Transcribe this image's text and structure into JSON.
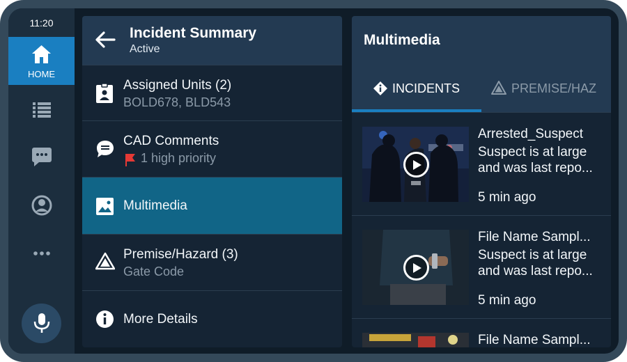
{
  "status": {
    "time": "11:20"
  },
  "rail": {
    "home_label": "HOME",
    "items": [
      "home-icon",
      "list-icon",
      "chat-icon",
      "profile-icon",
      "more-icon",
      "microphone-icon"
    ]
  },
  "incident": {
    "title": "Incident Summary",
    "status": "Active",
    "rows": [
      {
        "label": "Assigned Units (2)",
        "sub": "BOLD678, BLD543",
        "icon": "badge-icon"
      },
      {
        "label": "CAD Comments",
        "sub": "1 high priority",
        "icon": "comment-icon",
        "flag_color": "#e53935"
      },
      {
        "label": "Multimedia",
        "sub": "",
        "icon": "image-icon",
        "selected": true
      },
      {
        "label": "Premise/Hazard (3)",
        "sub": "Gate Code",
        "icon": "hazard-icon"
      },
      {
        "label": "More Details",
        "sub": "",
        "icon": "info-icon"
      }
    ]
  },
  "multimedia": {
    "title": "Multimedia",
    "tabs": [
      {
        "label": "INCIDENTS",
        "icon": "info-diamond-icon",
        "active": true
      },
      {
        "label": "PREMISE/HAZ",
        "icon": "hazard-icon",
        "active": false
      }
    ],
    "items": [
      {
        "name": "Arrested_Suspect",
        "desc": "Suspect is at large and was last repo...",
        "ago": "5 min ago"
      },
      {
        "name": "File Name Sampl...",
        "desc": "Suspect is at large and was last repo...",
        "ago": "5 min ago"
      },
      {
        "name": "File Name Sampl...",
        "desc": "",
        "ago": ""
      }
    ]
  },
  "colors": {
    "accent": "#1a7fc1",
    "selected_row": "#116587",
    "header": "#233a52",
    "background": "#0f1c28"
  }
}
